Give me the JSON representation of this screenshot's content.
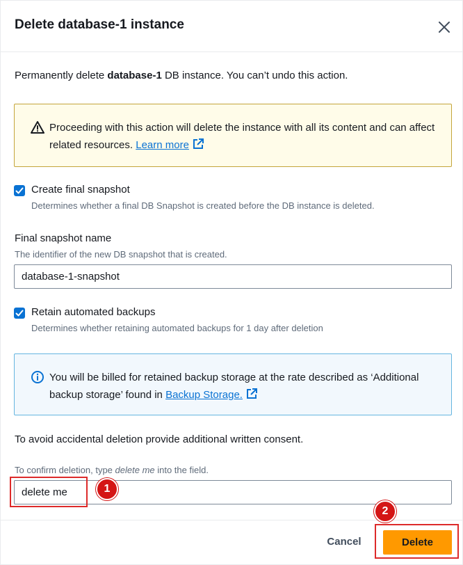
{
  "modal": {
    "title": "Delete database-1 instance",
    "intro_prefix": "Permanently delete ",
    "intro_bold": "database-1",
    "intro_suffix": " DB instance. You can’t undo this action."
  },
  "warning": {
    "text": "Proceeding with this action will delete the instance with all its content and can affect related resources.",
    "link": "Learn more"
  },
  "final_snapshot": {
    "checkbox_label": "Create final snapshot",
    "checkbox_desc": "Determines whether a final DB Snapshot is created before the DB instance is deleted.",
    "checked": true,
    "name_label": "Final snapshot name",
    "name_desc": "The identifier of the new DB snapshot that is created.",
    "name_value": "database-1-snapshot"
  },
  "backups": {
    "checkbox_label": "Retain automated backups",
    "checkbox_desc": "Determines whether retaining automated backups for 1 day after deletion",
    "checked": true
  },
  "info": {
    "text": "You will be billed for retained backup storage at the rate described as ‘Additional backup storage’ found in",
    "link": "Backup Storage."
  },
  "confirm": {
    "consent_text": "To avoid accidental deletion provide additional written consent.",
    "hint_prefix": "To confirm deletion, type ",
    "hint_keyword": "delete me",
    "hint_suffix": " into the field.",
    "value": "delete me"
  },
  "footer": {
    "cancel_label": "Cancel",
    "delete_label": "Delete"
  },
  "annotations": {
    "step_1": "1",
    "step_2": "2"
  },
  "colors": {
    "primary_button": "#ff9900",
    "link": "#0972d3",
    "annotation": "#dd2a2a",
    "warning_border": "#c4a43a",
    "info_border": "#64b5e0"
  }
}
